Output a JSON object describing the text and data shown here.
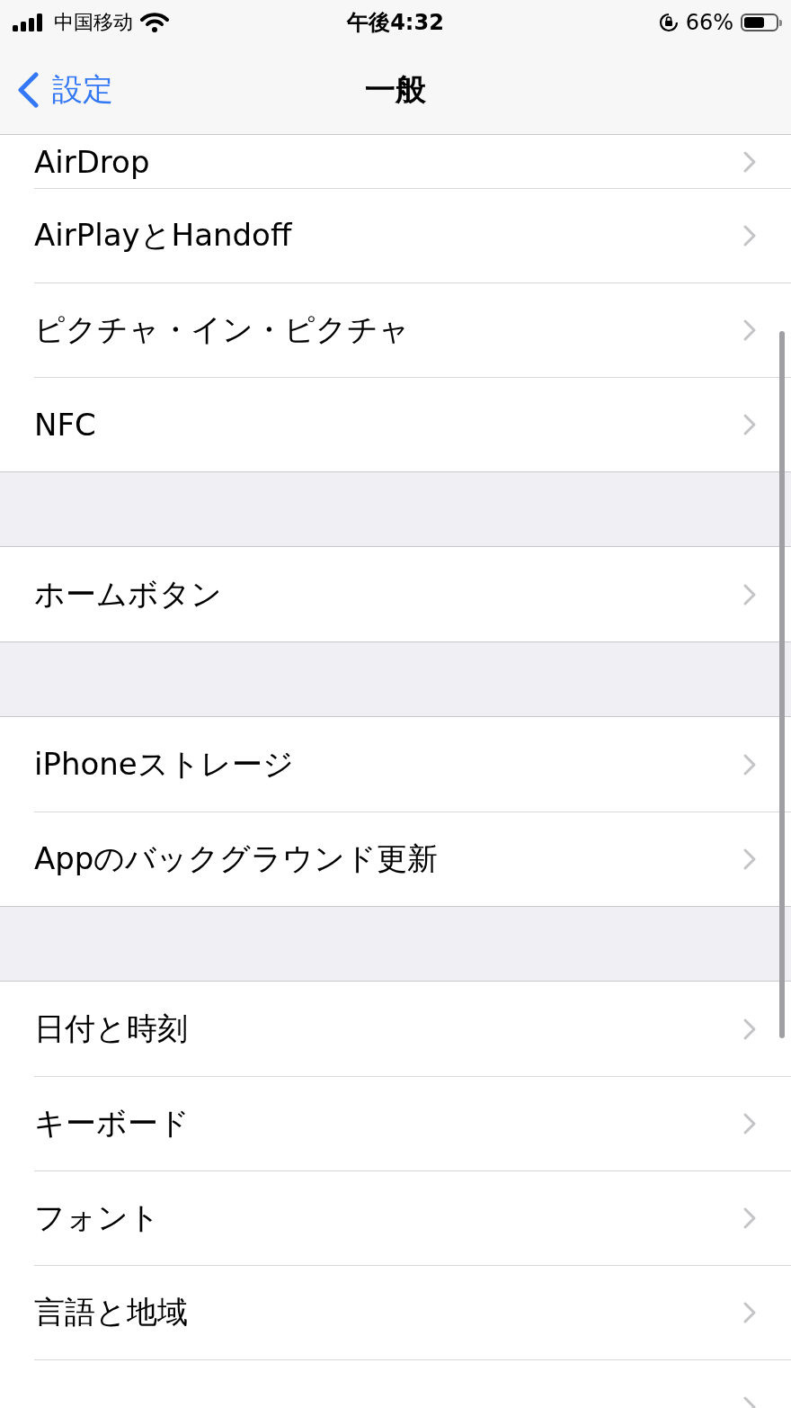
{
  "status_bar": {
    "carrier": "中国移动",
    "time": "午後4:32",
    "battery_percent": "66%"
  },
  "nav": {
    "back": "設定",
    "title": "一般"
  },
  "groups": [
    {
      "items": [
        {
          "label": "AirDrop"
        },
        {
          "label": "AirPlayとHandoff"
        },
        {
          "label": "ピクチャ・イン・ピクチャ"
        },
        {
          "label": "NFC"
        }
      ]
    },
    {
      "items": [
        {
          "label": "ホームボタン"
        }
      ]
    },
    {
      "items": [
        {
          "label": "iPhoneストレージ"
        },
        {
          "label": "Appのバックグラウンド更新"
        }
      ]
    },
    {
      "items": [
        {
          "label": "日付と時刻"
        },
        {
          "label": "キーボード"
        },
        {
          "label": "フォント"
        },
        {
          "label": "言語と地域"
        }
      ],
      "cut_off_row": true
    }
  ]
}
